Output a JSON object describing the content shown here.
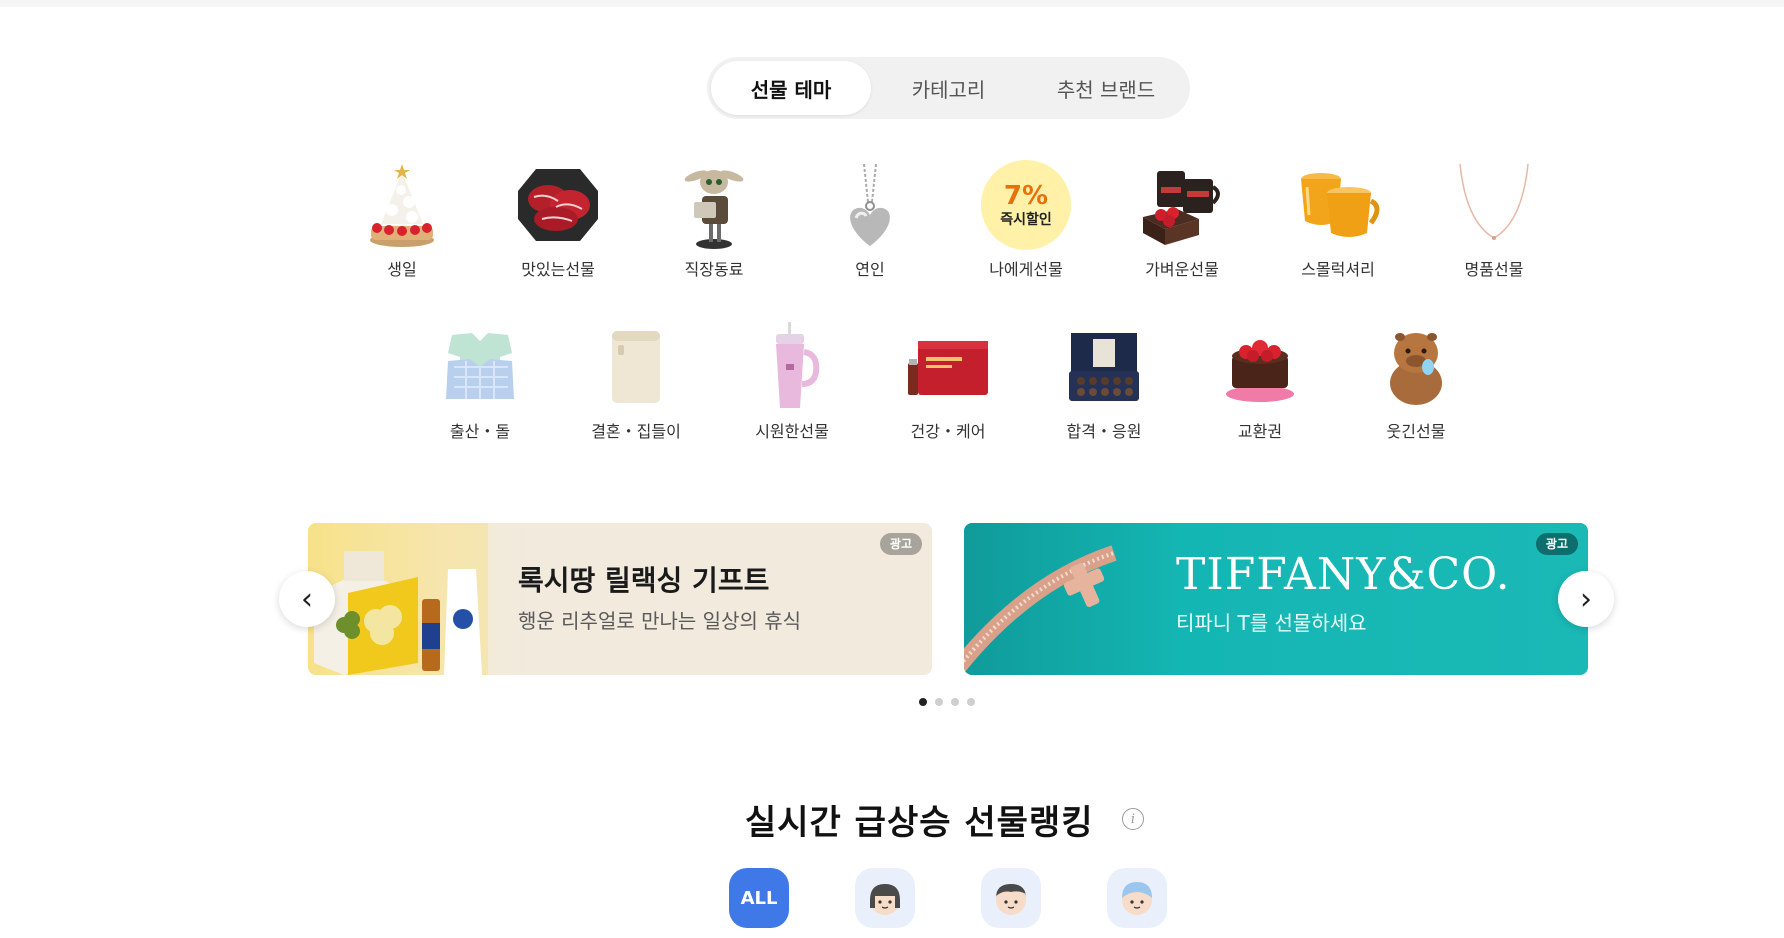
{
  "tabs": [
    {
      "label": "선물 테마",
      "active": true
    },
    {
      "label": "카테고리",
      "active": false
    },
    {
      "label": "추천 브랜드",
      "active": false
    }
  ],
  "themes": [
    {
      "label": "생일",
      "icon": "cake-icon"
    },
    {
      "label": "맛있는선물",
      "icon": "meat-icon"
    },
    {
      "label": "직장동료",
      "icon": "figure-icon"
    },
    {
      "label": "연인",
      "icon": "heart-necklace-icon"
    },
    {
      "label": "나에게선물",
      "icon": "discount-badge-icon",
      "badge_value": "7%",
      "badge_text": "즉시할인"
    },
    {
      "label": "가벼운선물",
      "icon": "coffee-icon"
    },
    {
      "label": "스몰럭셔리",
      "icon": "mug-icon"
    },
    {
      "label": "명품선물",
      "icon": "necklace-icon"
    },
    {
      "label": "출산・돌",
      "icon": "baby-clothes-icon"
    },
    {
      "label": "결혼・집들이",
      "icon": "appliance-icon"
    },
    {
      "label": "시원한선물",
      "icon": "tumbler-icon"
    },
    {
      "label": "건강・케어",
      "icon": "health-box-icon"
    },
    {
      "label": "합격・응원",
      "icon": "chocolate-box-icon"
    },
    {
      "label": "교환권",
      "icon": "strawberry-cake-icon"
    },
    {
      "label": "웃긴선물",
      "icon": "capybara-icon"
    }
  ],
  "banners": [
    {
      "title": "록시땅 릴랙싱 기프트",
      "subtitle": "행운 리추얼로 만나는 일상의 휴식",
      "ad_label": "광고"
    },
    {
      "title": "TIFFANY&CO.",
      "subtitle": "티파니 T를 선물하세요",
      "ad_label": "광고"
    }
  ],
  "carousel": {
    "prev_icon": "chevron-left-icon",
    "next_icon": "chevron-right-icon",
    "page_count": 4,
    "active_index": 0
  },
  "ranking": {
    "title": "실시간 급상승 선물랭킹",
    "filters": [
      {
        "label": "ALL",
        "active": true
      },
      {
        "icon": "woman-avatar-icon"
      },
      {
        "icon": "man-avatar-icon"
      },
      {
        "icon": "baby-avatar-icon"
      }
    ]
  },
  "colors": {
    "accent": "#3f79e8",
    "tiffany": "#14b6b3"
  }
}
